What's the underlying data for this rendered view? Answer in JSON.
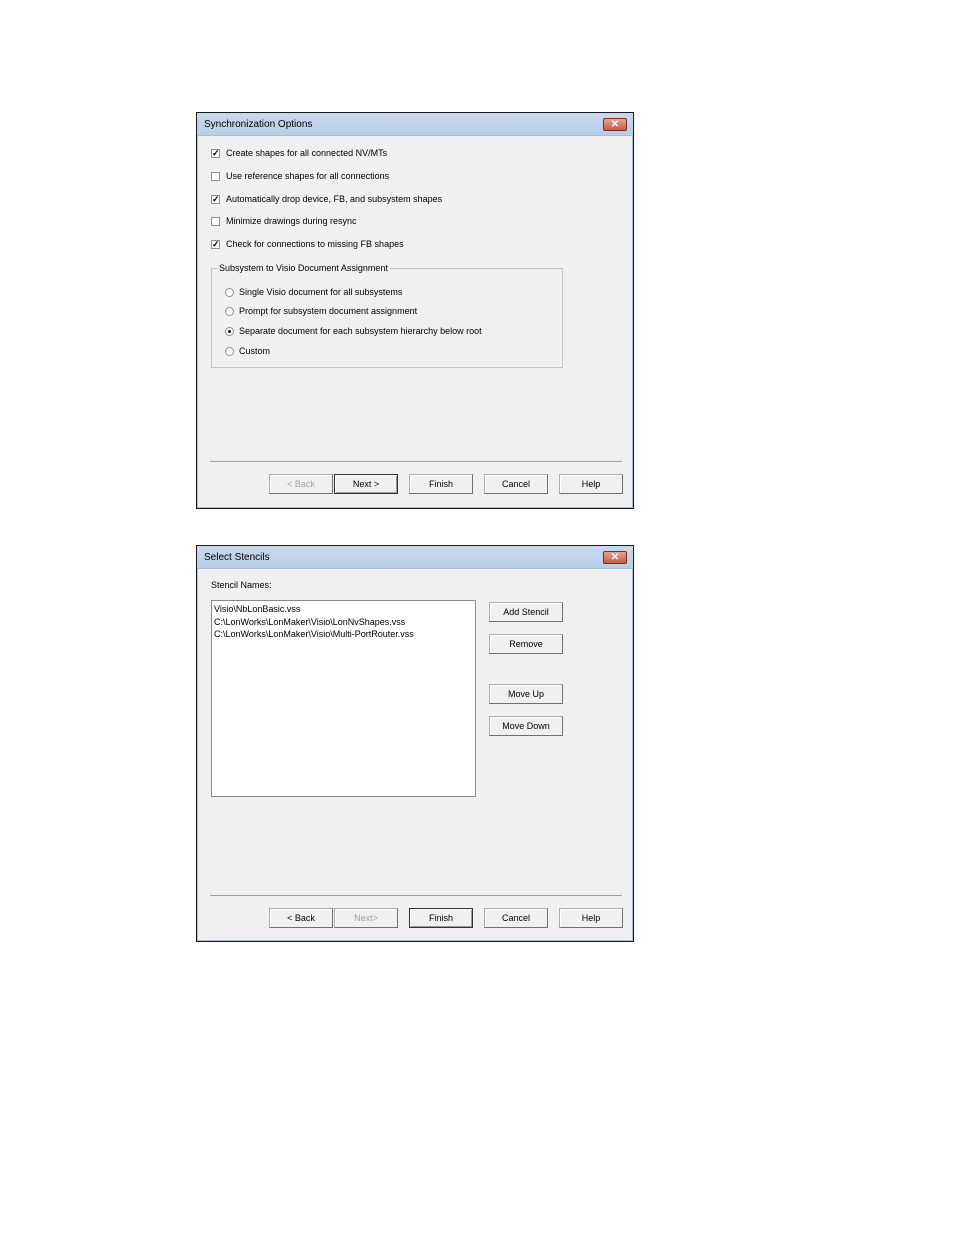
{
  "sync_dialog": {
    "title": "Synchronization Options",
    "close_glyph": "✕",
    "checkboxes": [
      {
        "label": "Create shapes for all connected NV/MTs",
        "checked": true
      },
      {
        "label": "Use reference shapes for all connections",
        "checked": false
      },
      {
        "label": "Automatically drop device, FB, and subsystem shapes",
        "checked": true
      },
      {
        "label": "Minimize drawings during resync",
        "checked": false
      },
      {
        "label": "Check for connections to missing FB shapes",
        "checked": true
      }
    ],
    "group_label": "Subsystem to Visio Document Assignment",
    "radios": [
      {
        "label": "Single Visio document for all subsystems",
        "selected": false
      },
      {
        "label": "Prompt for subsystem document assignment",
        "selected": false
      },
      {
        "label": "Separate document for each subsystem hierarchy below root",
        "selected": true
      },
      {
        "label": "Custom",
        "selected": false
      }
    ],
    "buttons": {
      "back": "< Back",
      "next": "Next >",
      "finish": "Finish",
      "cancel": "Cancel",
      "help": "Help"
    }
  },
  "stencil_dialog": {
    "title": "Select Stencils",
    "close_glyph": "✕",
    "list_label": "Stencil Names:",
    "stencils": [
      "Visio\\NbLonBasic.vss",
      "C:\\LonWorks\\LonMaker\\Visio\\LonNvShapes.vss",
      "C:\\LonWorks\\LonMaker\\Visio\\Multi-PortRouter.vss"
    ],
    "side_buttons": {
      "add": "Add Stencil",
      "remove": "Remove",
      "move_up": "Move Up",
      "move_down": "Move Down"
    },
    "buttons": {
      "back": "< Back",
      "next": "Next>",
      "finish": "Finish",
      "cancel": "Cancel",
      "help": "Help"
    }
  }
}
